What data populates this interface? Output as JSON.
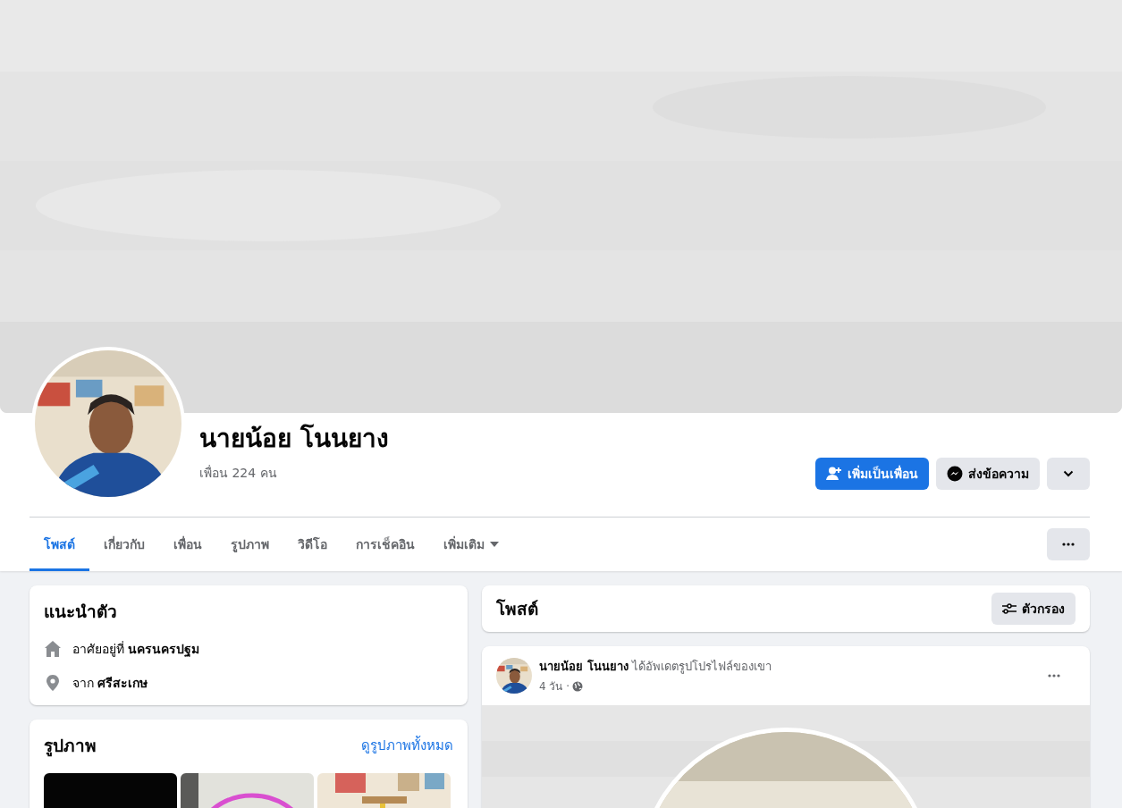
{
  "profile": {
    "name": "นายน้อย โนนยาง",
    "friends": "เพื่อน 224 คน"
  },
  "actions": [
    {
      "kind": "add-friend",
      "label": "เพิ่มเป็นเพื่อน"
    },
    {
      "kind": "message",
      "label": "ส่งข้อความ"
    },
    {
      "kind": "dropdown"
    }
  ],
  "tabs": [
    {
      "label": "โพสต์",
      "selected": true,
      "dropdown": false
    },
    {
      "label": "เกี่ยวกับ",
      "selected": false,
      "dropdown": false
    },
    {
      "label": "เพื่อน",
      "selected": false,
      "dropdown": false
    },
    {
      "label": "รูปภาพ",
      "selected": false,
      "dropdown": false
    },
    {
      "label": "วิดีโอ",
      "selected": false,
      "dropdown": false
    },
    {
      "label": "การเช็คอิน",
      "selected": false,
      "dropdown": false
    },
    {
      "label": "เพิ่มเติม",
      "selected": false,
      "dropdown": true
    }
  ],
  "intro": {
    "title": "แนะนำตัว",
    "items": [
      {
        "kind": "home",
        "text": "อาศัยอยู่ที่ **นครนครปฐม**"
      },
      {
        "kind": "location",
        "text": "จาก **ศรีสะเกษ**"
      }
    ]
  },
  "photos": {
    "title": "รูปภาพ",
    "link": "ดูรูปภาพทั้งหมด",
    "items": [
      {
        "kind": "dark"
      },
      {
        "kind": "ring"
      },
      {
        "kind": "room"
      }
    ]
  },
  "posts_header": {
    "title": "โพสต์",
    "filter": "ตัวกรอง"
  },
  "post": {
    "headline": "**นายน้อย โนนยาง** ได้อัพเดตรูปโปรไฟล์ของเขา",
    "time": "4 วัน ·"
  }
}
